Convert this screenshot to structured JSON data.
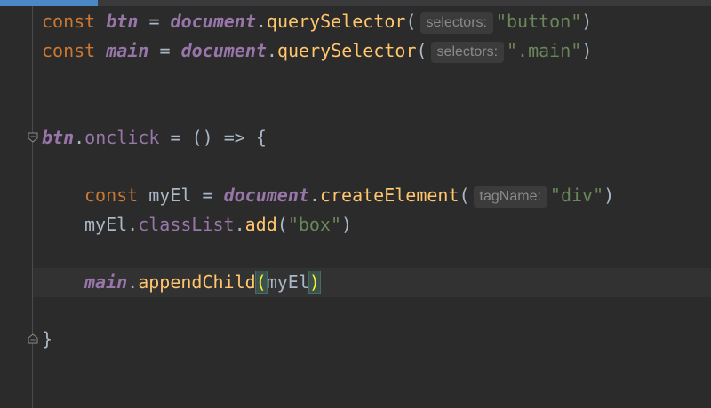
{
  "code": {
    "line1": {
      "kw": "const",
      "var": "btn",
      "eq": "=",
      "obj": "document",
      "fn": "querySelector",
      "hint": "selectors:",
      "str": "\"button\""
    },
    "line2": {
      "kw": "const",
      "var": "main",
      "eq": "=",
      "obj": "document",
      "fn": "querySelector",
      "hint": "selectors:",
      "str": "\".main\""
    },
    "line3": {
      "var": "btn",
      "prop": "onclick",
      "rest": " = () => {"
    },
    "line4": {
      "kw": "const",
      "name": "myEl",
      "eq": "=",
      "obj": "document",
      "fn": "createElement",
      "hint": "tagName:",
      "str": "\"div\""
    },
    "line5": {
      "name": "myEl",
      "prop": "classList",
      "fn": "add",
      "str": "\"box\""
    },
    "line6": {
      "var": "main",
      "fn": "appendChild",
      "arg": "myEl"
    },
    "line7": {
      "brace": "}"
    }
  },
  "colors": {
    "background": "#2b2b2b",
    "keyword": "#cc7832",
    "variable": "#9876aa",
    "function": "#ffc66d",
    "string": "#6a8759",
    "default": "#a9b7c6"
  }
}
